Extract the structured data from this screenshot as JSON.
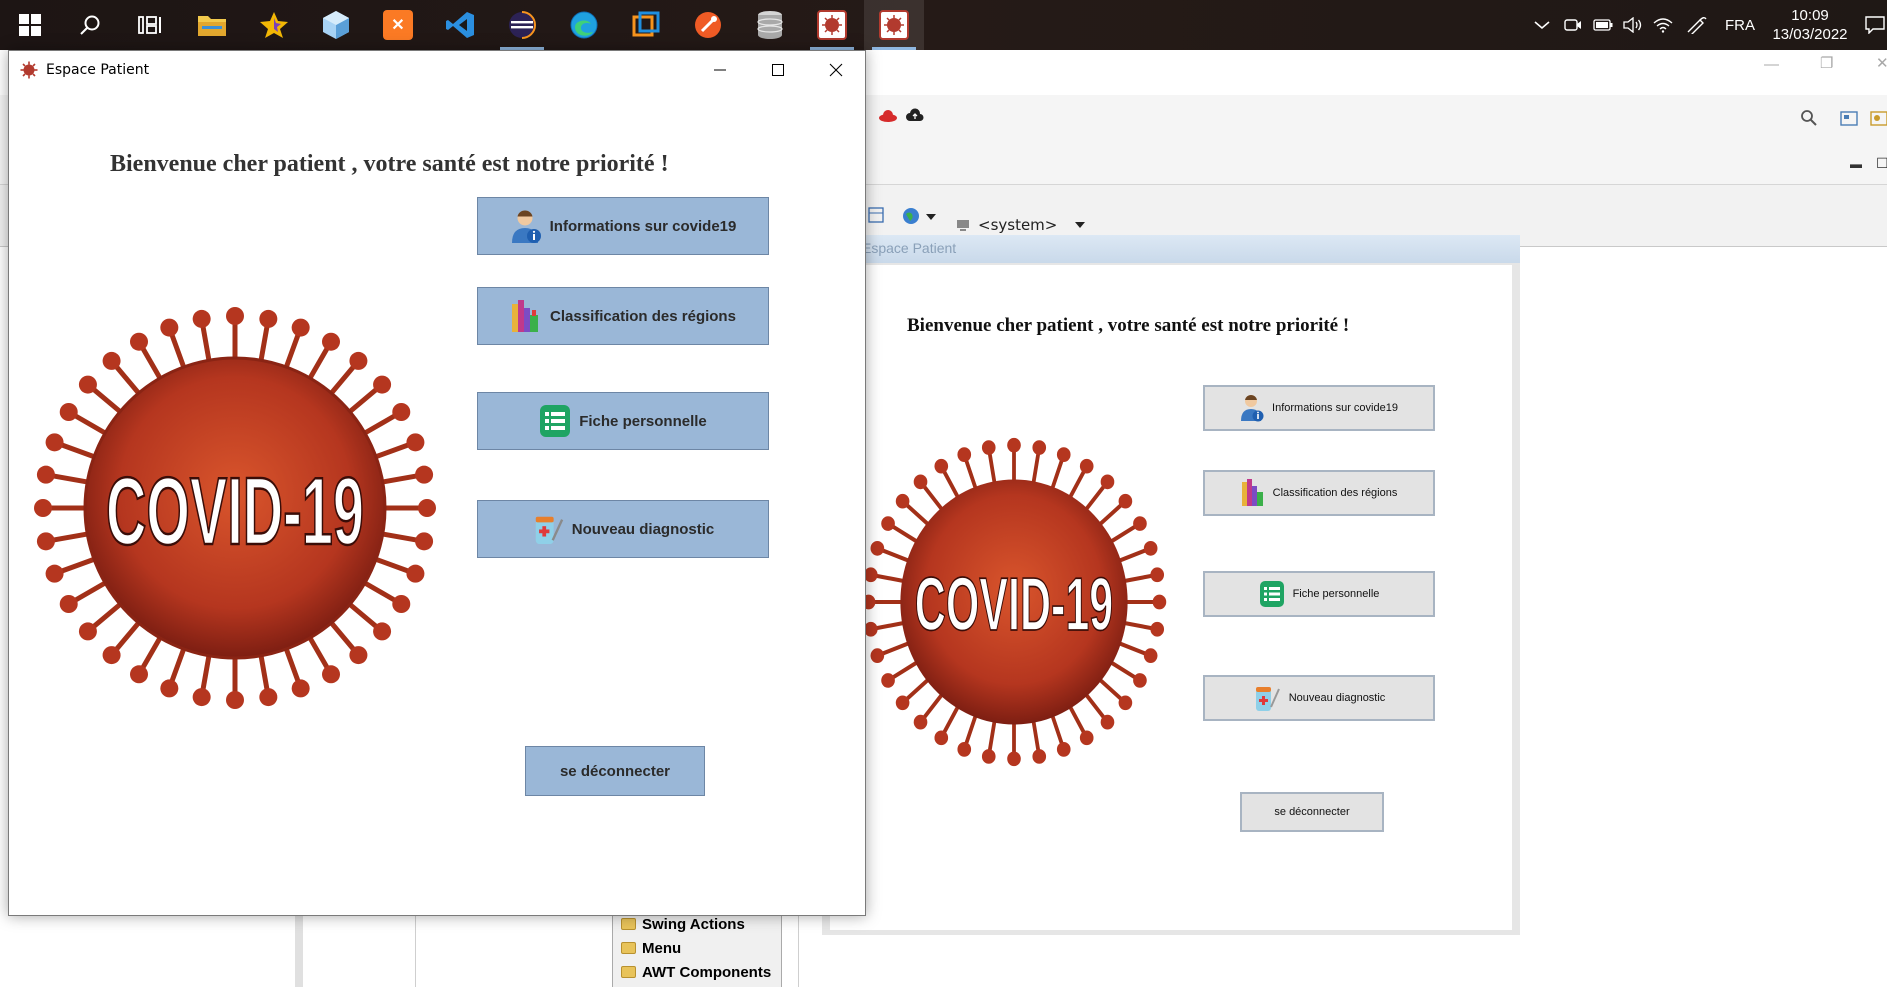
{
  "taskbar": {
    "apps": [
      {
        "name": "windows-start",
        "icon": "windows-logo-icon",
        "color": "#ffffff"
      },
      {
        "name": "search",
        "icon": "search-icon",
        "color": "#ffffff"
      },
      {
        "name": "task-view",
        "icon": "task-view-icon",
        "color": "#ffffff"
      },
      {
        "name": "file-explorer",
        "icon": "folder-icon",
        "color": "#f2c94c"
      },
      {
        "name": "star-app",
        "icon": "star-icon",
        "color": "#f2b705"
      },
      {
        "name": "cube-app",
        "icon": "cube-icon",
        "color": "#7ab6e8"
      },
      {
        "name": "xampp",
        "icon": "xampp-icon",
        "color": "#fb7a24"
      },
      {
        "name": "vscode",
        "icon": "vscode-icon",
        "color": "#2b8fe0"
      },
      {
        "name": "eclipse",
        "icon": "eclipse-icon",
        "color": "#2c2255"
      },
      {
        "name": "edge",
        "icon": "edge-icon",
        "color": "#1fa1e0"
      },
      {
        "name": "virtualbox",
        "icon": "cube-outline-icon",
        "color": "#1f8fe0"
      },
      {
        "name": "postman",
        "icon": "postman-icon",
        "color": "#ef5b25"
      },
      {
        "name": "database",
        "icon": "database-icon",
        "color": "#b9b9b9"
      },
      {
        "name": "covid-app-1",
        "icon": "covid-app-icon",
        "color": "#b23a2e"
      },
      {
        "name": "covid-app-2",
        "icon": "covid-app-icon",
        "color": "#b23a2e"
      }
    ],
    "tray": {
      "language": "FRA",
      "time": "10:09",
      "date": "13/03/2022"
    }
  },
  "ide": {
    "system_combo": "<system>",
    "preview": {
      "title": "Espace Patient",
      "heading": "Bienvenue cher patient , votre santé est notre priorité !",
      "buttons": [
        "Informations sur covide19",
        "Classification des régions",
        "Fiche personnelle",
        "Nouveau diagnostic"
      ],
      "logout": "se déconnecter",
      "virus_text": "COVID-19"
    },
    "palette": {
      "items": [
        "Swing Actions",
        "Menu",
        "AWT Components"
      ]
    }
  },
  "window": {
    "title": "Espace Patient",
    "heading": "Bienvenue cher patient , votre santé est notre priorité !",
    "virus_text": "COVID-19",
    "buttons": {
      "info": "Informations sur covide19",
      "classification": "Classification des régions",
      "fiche": "Fiche personnelle",
      "diagnostic": "Nouveau diagnostic"
    },
    "logout": "se déconnecter"
  },
  "colors": {
    "button_bg": "#9ab7d7",
    "button_border": "#6d86a5",
    "virus_red": "#b5361f",
    "taskbar_bg": "#211816"
  }
}
